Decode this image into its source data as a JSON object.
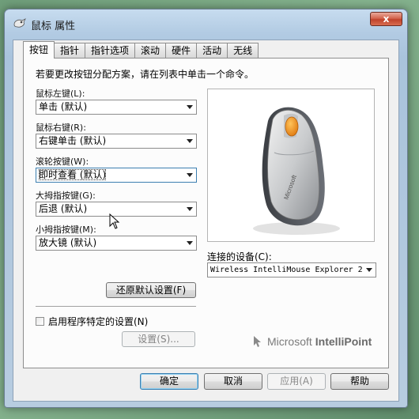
{
  "window": {
    "title": "鼠标 属性",
    "close_label": "x"
  },
  "tabs": [
    {
      "label": "按钮",
      "active": true
    },
    {
      "label": "指针",
      "active": false
    },
    {
      "label": "指针选项",
      "active": false
    },
    {
      "label": "滚动",
      "active": false
    },
    {
      "label": "硬件",
      "active": false
    },
    {
      "label": "活动",
      "active": false
    },
    {
      "label": "无线",
      "active": false
    }
  ],
  "panel": {
    "instruction": "若要更改按钮分配方案，请在列表中单击一个命令。",
    "fields": [
      {
        "label": "鼠标左键(L):",
        "value": "单击 (默认)"
      },
      {
        "label": "鼠标右键(R):",
        "value": "右键单击 (默认)"
      },
      {
        "label": "滚轮按键(W):",
        "value": "即时查看 (默认)"
      },
      {
        "label": "大拇指按键(G):",
        "value": "后退 (默认)"
      },
      {
        "label": "小拇指按键(M):",
        "value": "放大镜 (默认)"
      }
    ],
    "restore_label": "还原默认设置(F)",
    "checkbox_label": "启用程序特定的设置(N)",
    "checkbox_checked": false,
    "settings_label": "设置(S)...",
    "device_label": "连接的设备(C):",
    "device_value": "Wireless IntelliMouse Explorer 2",
    "brand": {
      "microsoft": "Microsoft",
      "product": "IntelliPoint"
    }
  },
  "buttons": {
    "ok": "确定",
    "cancel": "取消",
    "apply": "应用(A)",
    "help": "帮助"
  },
  "colors": {
    "mouse_accent": "#f7941d",
    "mouse_body": "#c8cacc",
    "focus_border": "#3c7fb1"
  }
}
